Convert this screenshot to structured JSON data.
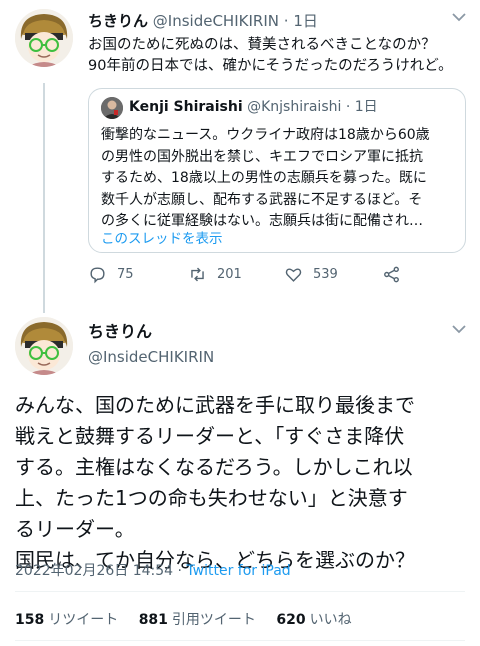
{
  "tweet1": {
    "name": "ちきりん",
    "handle": "@InsideCHIKIRIN",
    "time": "1日",
    "lines": [
      "お国のために死ぬのは、賛美されるべきことなのか？",
      "90年前の日本では、確かにそうだったのだろうけれど。"
    ],
    "quote": {
      "name": "Kenji Shiraishi",
      "handle": "@Knjshiraishi",
      "time": "1日",
      "lines": [
        "衝撃的なニュース。ウクライナ政府は18歳から60歳",
        "の男性の国外脱出を禁じ、キエフでロシア軍に抵抗",
        "するため、18歳以上の男性の志願兵を募った。既に",
        "数千人が志願し、配布する武器に不足するほど。そ",
        "の多くに従軍経験はない。志願兵は街に配備され…"
      ],
      "thread_link": "このスレッドを表示"
    },
    "actions": {
      "replies": "75",
      "retweets": "201",
      "likes": "539",
      "icons": [
        "reply-icon",
        "retweet-icon",
        "like-icon",
        "share-icon"
      ]
    }
  },
  "tweet2": {
    "name": "ちきりん",
    "handle": "@InsideCHIKIRIN",
    "lines": [
      "みんな、国のために武器を手に取り最後まで",
      "戦えと鼓舞するリーダーと、「すぐさま降伏",
      "する。主権はなくなるだろう。しかしこれ以",
      "上、たった1つの命も失わせない」と決意す",
      "るリーダー。",
      "国民は、てか自分なら、どちらを選ぶのか？"
    ],
    "timestamp": "2022年02月26日 14:54",
    "separator": "·",
    "source": "Twitter for iPad",
    "stats": {
      "retweets_count": "158",
      "retweets_label": "リツイート",
      "quotes_count": "881",
      "quotes_label": "引用ツイート",
      "likes_count": "620",
      "likes_label": "いいね"
    }
  },
  "colors": {
    "link": "#1d9bf0",
    "secondary_text": "#536471",
    "primary_text": "#0f1419",
    "border": "#cfd9de"
  }
}
